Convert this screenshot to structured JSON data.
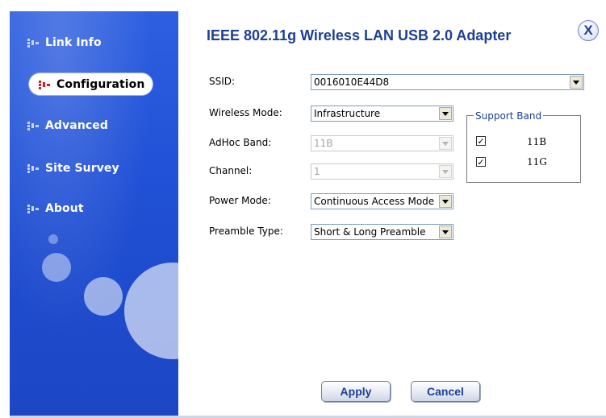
{
  "window": {
    "title": "IEEE 802.11g Wireless LAN USB 2.0 Adapter",
    "close_label": "X"
  },
  "sidebar": {
    "items": [
      {
        "label": "Link Info",
        "active": false
      },
      {
        "label": "Configuration",
        "active": true
      },
      {
        "label": "Advanced",
        "active": false
      },
      {
        "label": "Site Survey",
        "active": false
      },
      {
        "label": "About",
        "active": false
      }
    ],
    "colors": {
      "background": "#2151d6",
      "active_bullet": "#e01a1a"
    }
  },
  "form": {
    "ssid": {
      "label": "SSID:",
      "value": "0016010E44D8"
    },
    "wireless_mode": {
      "label": "Wireless Mode:",
      "value": "Infrastructure"
    },
    "adhoc_band": {
      "label": "AdHoc Band:",
      "value": "11B",
      "disabled": true
    },
    "channel": {
      "label": "Channel:",
      "value": "1",
      "disabled": true
    },
    "power_mode": {
      "label": "Power Mode:",
      "value": "Continuous Access Mode"
    },
    "preamble_type": {
      "label": "Preamble Type:",
      "value": "Short & Long Preamble"
    }
  },
  "support_band": {
    "title": "Support Band",
    "options": [
      {
        "label": "11B",
        "checked": true
      },
      {
        "label": "11G",
        "checked": true
      }
    ]
  },
  "buttons": {
    "apply": "Apply",
    "cancel": "Cancel"
  },
  "colors": {
    "title_text": "#1d3f96",
    "accent": "#2151d6"
  }
}
